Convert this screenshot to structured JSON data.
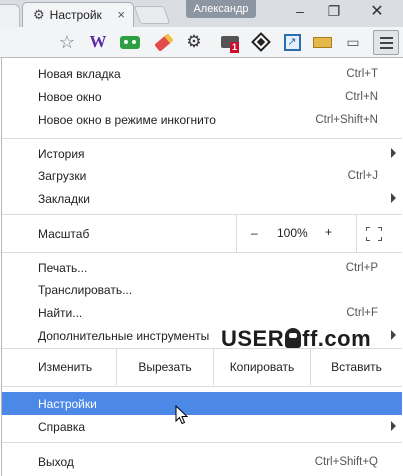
{
  "tabs": {
    "active_title": "Настройк",
    "close_glyph": "×",
    "profile_name": "Александр"
  },
  "window": {
    "minimize": "–",
    "maximize": "❐",
    "close": "✕"
  },
  "toolbar": {
    "extensions": [
      "bookmark-star",
      "wikipedia",
      "robot",
      "eraser",
      "gear",
      "camera-badge",
      "diamond",
      "arrow-box",
      "ruler",
      "cast"
    ],
    "wiki_letter": "W",
    "badge_count": "1",
    "gear_glyph": "⚙",
    "star_glyph": "☆",
    "arrow_glyph": "↗",
    "cast_glyph": "▭"
  },
  "menu": {
    "new_tab": {
      "label": "Новая вкладка",
      "shortcut": "Ctrl+T"
    },
    "new_window": {
      "label": "Новое окно",
      "shortcut": "Ctrl+N"
    },
    "incognito": {
      "label": "Новое окно в режиме инкогнито",
      "shortcut": "Ctrl+Shift+N"
    },
    "history": {
      "label": "История"
    },
    "downloads": {
      "label": "Загрузки",
      "shortcut": "Ctrl+J"
    },
    "bookmarks": {
      "label": "Закладки"
    },
    "zoom": {
      "label": "Масштаб",
      "minus": "–",
      "value": "100%",
      "plus": "+"
    },
    "print": {
      "label": "Печать...",
      "shortcut": "Ctrl+P"
    },
    "cast": {
      "label": "Транслировать..."
    },
    "find": {
      "label": "Найти...",
      "shortcut": "Ctrl+F"
    },
    "more_tools": {
      "label": "Дополнительные инструменты"
    },
    "edit": {
      "label": "Изменить",
      "cut": "Вырезать",
      "copy": "Копировать",
      "paste": "Вставить"
    },
    "settings": {
      "label": "Настройки"
    },
    "help": {
      "label": "Справка"
    },
    "exit": {
      "label": "Выход",
      "shortcut": "Ctrl+Shift+Q"
    }
  },
  "watermark": {
    "part1": "USER",
    "part2": "ff.com"
  },
  "colors": {
    "highlight": "#4c89e7",
    "profile": "#8c95a2"
  }
}
